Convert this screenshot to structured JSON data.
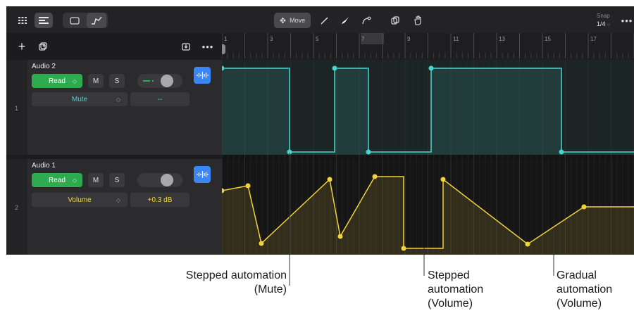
{
  "toolbar": {
    "move_label": "Move",
    "snap_label": "Snap",
    "snap_value": "1/4"
  },
  "ruler": {
    "bars": [
      "1",
      "3",
      "5",
      "7",
      "9",
      "11",
      "13",
      "15",
      "17"
    ]
  },
  "tracks": [
    {
      "number": "1",
      "name": "Audio 2",
      "automation_mode": "Read",
      "mute_label": "M",
      "solo_label": "S",
      "parameter": "Mute",
      "parameter_value": "--",
      "automation_color": "#46d6d0"
    },
    {
      "number": "2",
      "name": "Audio 1",
      "automation_mode": "Read",
      "mute_label": "M",
      "solo_label": "S",
      "parameter": "Volume",
      "parameter_value": "+0.3 dB",
      "automation_color": "#f1d23c"
    }
  ],
  "callouts": {
    "stepped_mute_line1": "Stepped automation",
    "stepped_mute_line2": "(Mute)",
    "stepped_volume_line1": "Stepped",
    "stepped_volume_line2": "automation",
    "stepped_volume_line3": "(Volume)",
    "gradual_line1": "Gradual",
    "gradual_line2": "automation",
    "gradual_line3": "(Volume)"
  },
  "colors": {
    "app_background": "#1e1e20",
    "read_green": "#2eaa4f",
    "mute_automation": "#46d6d0",
    "volume_automation": "#f1d23c",
    "waveform_button": "#3b86f7"
  },
  "icons": {
    "toolbar_left": [
      "grid-icon",
      "track-list-icon",
      "rectangle-icon",
      "automation-icon"
    ],
    "toolbar_center": [
      "move-icon",
      "pencil-icon",
      "brush-icon",
      "curve-icon",
      "copy-icon",
      "hand-icon"
    ],
    "toolbar_right": [
      "more-icon"
    ],
    "header_bar": [
      "add-icon",
      "duplicate-icon",
      "download-icon",
      "more-icon"
    ]
  }
}
